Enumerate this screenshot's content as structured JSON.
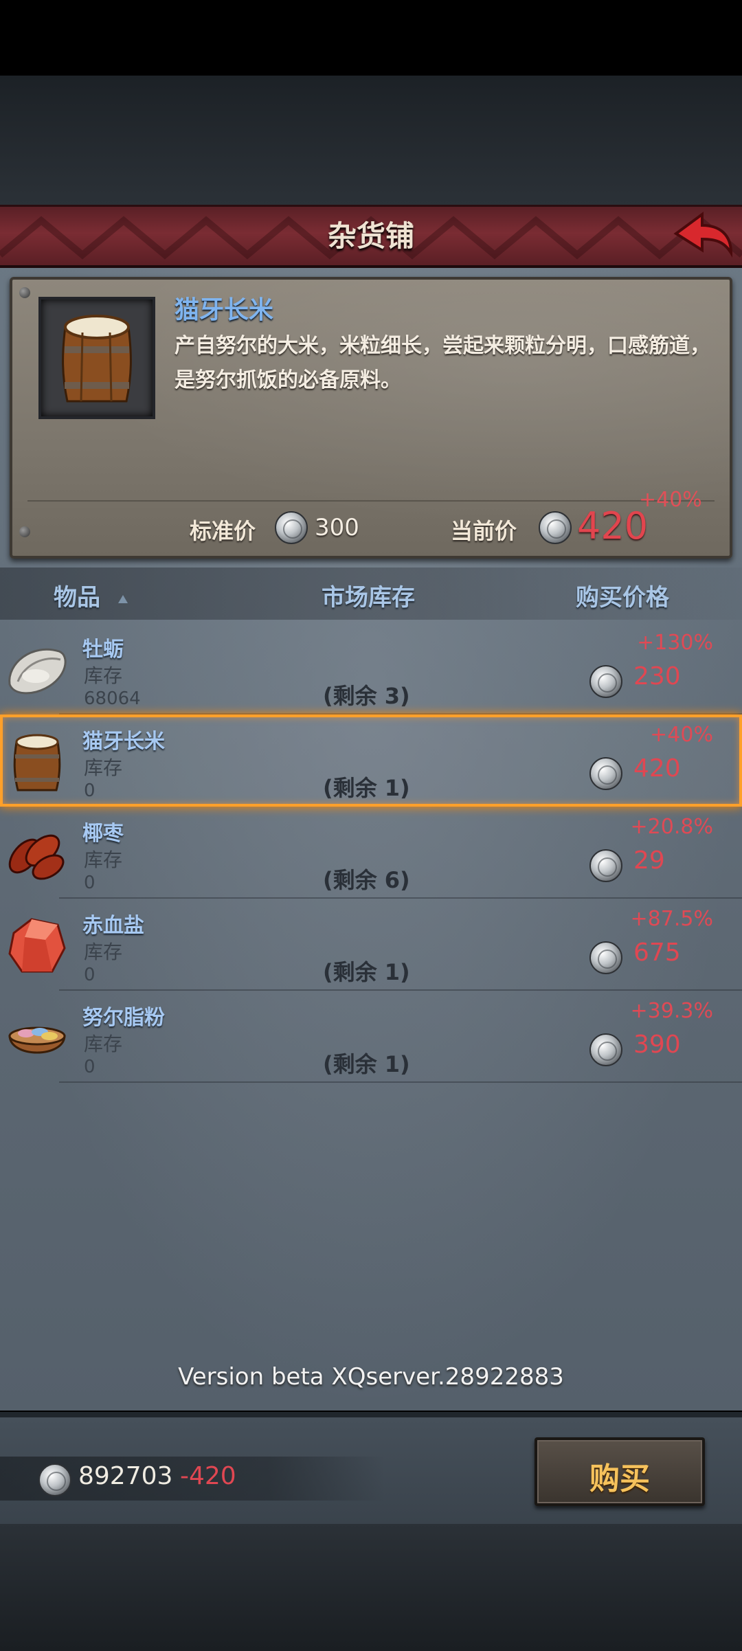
{
  "shop": {
    "title": "杂货铺"
  },
  "selected_item": {
    "name": "猫牙长米",
    "description": "产自努尔的大米，米粒细长，尝起来颗粒分明，口感筋道，是努尔抓饭的必备原料。",
    "standard_price_label": "标准价",
    "standard_price": "300",
    "current_price_label": "当前价",
    "current_price": "420",
    "current_price_change": "+40%"
  },
  "list_header": {
    "item": "物品",
    "market_stock": "市场库存",
    "buy_price": "购买价格"
  },
  "items": [
    {
      "name": "牡蛎",
      "stock_label": "库存",
      "stock": "68064",
      "remaining": "(剩余 3)",
      "change": "+130%",
      "price": "230",
      "icon": "oyster-icon"
    },
    {
      "name": "猫牙长米",
      "stock_label": "库存",
      "stock": "0",
      "remaining": "(剩余 1)",
      "change": "+40%",
      "price": "420",
      "icon": "rice-barrel-icon"
    },
    {
      "name": "椰枣",
      "stock_label": "库存",
      "stock": "0",
      "remaining": "(剩余 6)",
      "change": "+20.8%",
      "price": "29",
      "icon": "dates-icon"
    },
    {
      "name": "赤血盐",
      "stock_label": "库存",
      "stock": "0",
      "remaining": "(剩余 1)",
      "change": "+87.5%",
      "price": "675",
      "icon": "red-salt-icon"
    },
    {
      "name": "努尔脂粉",
      "stock_label": "库存",
      "stock": "0",
      "remaining": "(剩余 1)",
      "change": "+39.3%",
      "price": "390",
      "icon": "powder-bowl-icon"
    }
  ],
  "version": "Version beta XQserver.28922883",
  "wallet": {
    "balance": "892703",
    "delta": "-420"
  },
  "buy_button": {
    "label": "购买"
  },
  "colors": {
    "accent_red": "#e04752",
    "name_blue": "#a7c9f2",
    "selection_orange": "#ffa02a",
    "buy_gold": "#f6c25c"
  }
}
